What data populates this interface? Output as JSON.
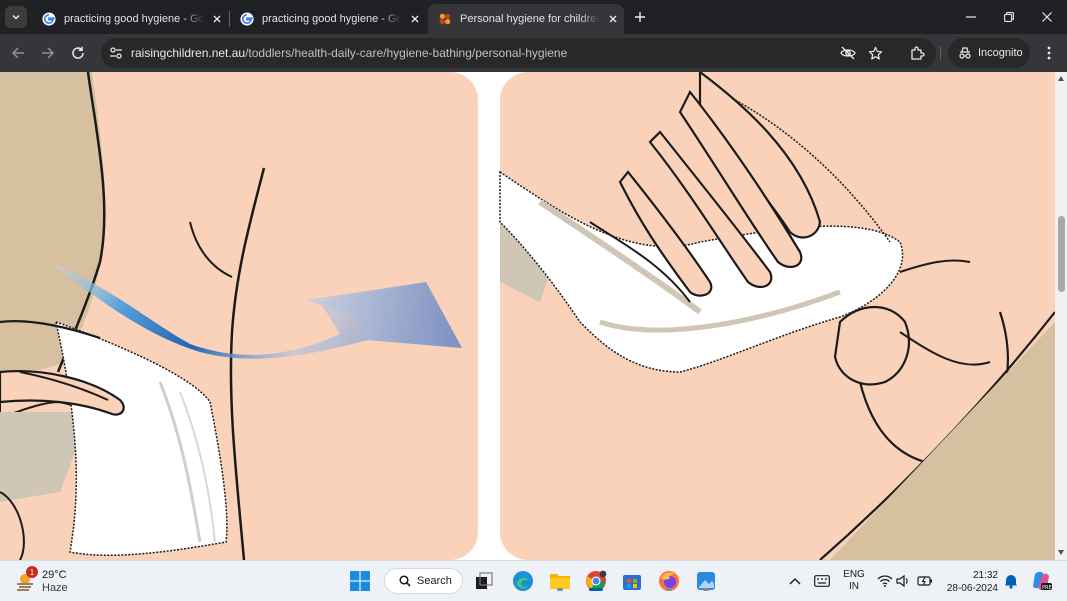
{
  "browser": {
    "tabs": [
      {
        "title": "practicing good hygiene - Google Search",
        "favicon": "google-icon",
        "active": false
      },
      {
        "title": "practicing good hygiene - Google Search",
        "favicon": "google-icon",
        "active": false
      },
      {
        "title": "Personal hygiene for children: information",
        "favicon": "raising-children-icon",
        "active": true
      }
    ],
    "url_host": "raisingchildren.net.au",
    "url_path": "/toddlers/health-daily-care/hygiene-bathing/personal-hygiene",
    "incognito_label": "Incognito"
  },
  "page": {
    "illustration_left": "baby-bottom-wipe-front-to-back-illustration",
    "illustration_right": "hand-wiping-with-cloth-illustration",
    "skin_color": "#f9d2b9",
    "arrow_colors": [
      "#5aa0d8",
      "#1e64b4",
      "#8a9cc8"
    ]
  },
  "taskbar": {
    "weather": {
      "temp": "29°C",
      "condition": "Haze",
      "badge": "1"
    },
    "search_label": "Search",
    "language": {
      "line1": "ENG",
      "line2": "IN"
    },
    "clock": {
      "time": "21:32",
      "date": "28-06-2024"
    }
  }
}
